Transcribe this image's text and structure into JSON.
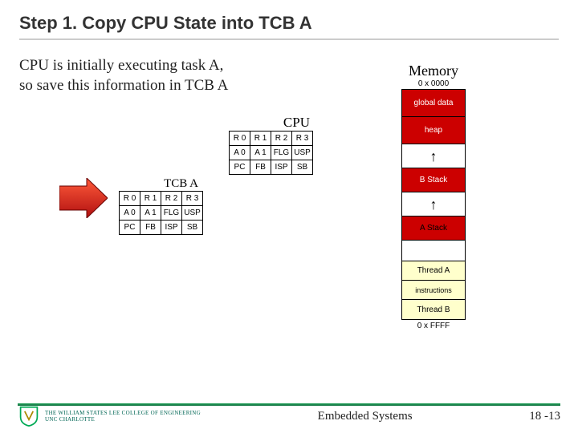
{
  "title": "Step 1. Copy CPU State into TCB A",
  "subtitle_line1": "CPU is initially executing task A,",
  "subtitle_line2": "so save this information in TCB A",
  "cpu": {
    "label": "CPU",
    "rows": [
      [
        "R 0",
        "R 1",
        "R 2",
        "R 3"
      ],
      [
        "A 0",
        "A 1",
        "FLG",
        "USP"
      ],
      [
        "PC",
        "FB",
        "ISP",
        "SB"
      ]
    ]
  },
  "tcb": {
    "label": "TCB A",
    "rows": [
      [
        "R 0",
        "R 1",
        "R 2",
        "R 3"
      ],
      [
        "A 0",
        "A 1",
        "FLG",
        "USP"
      ],
      [
        "PC",
        "FB",
        "ISP",
        "SB"
      ]
    ]
  },
  "memory": {
    "title": "Memory",
    "start": "0 x 0000",
    "end": "0 x FFFF",
    "segments": {
      "globals": "global data",
      "heap": "heap",
      "bstack": "B Stack",
      "astack": "A Stack",
      "thread_a": "Thread A",
      "instructions": "instructions",
      "thread_b": "Thread B"
    }
  },
  "footer": {
    "center": "Embedded Systems",
    "page": "18 -13",
    "org_line1": "THE WILLIAM STATES LEE COLLEGE of ENGINEERING",
    "org_line2": "UNC CHARLOTTE"
  }
}
